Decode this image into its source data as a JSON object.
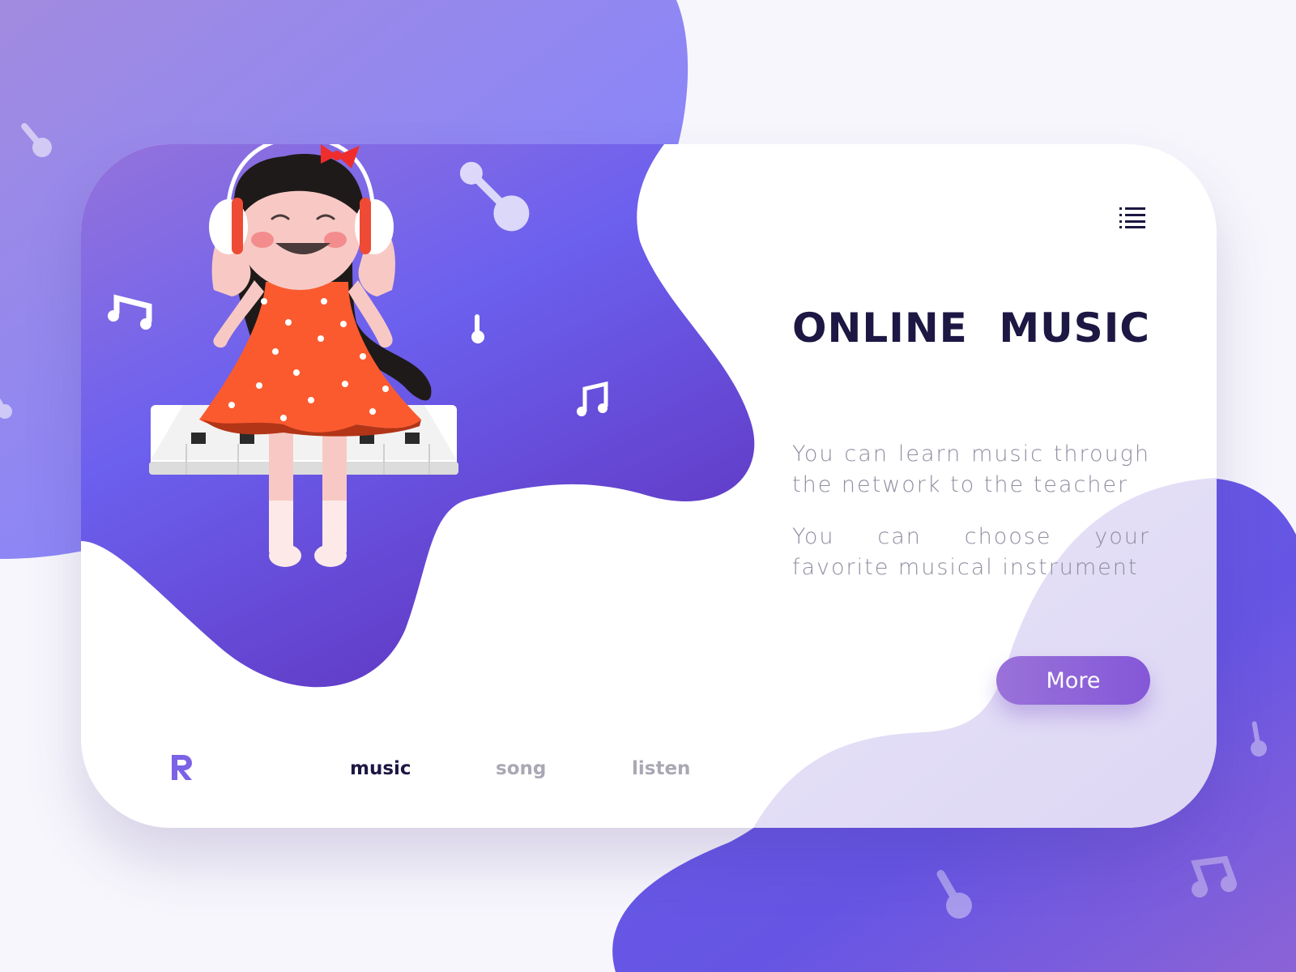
{
  "header": {
    "title_words": [
      "ONLINE",
      "MUSIC"
    ]
  },
  "content": {
    "paragraphs": [
      "You can learn music through the network to the teacher",
      "You can choose your favorite musical instrument"
    ],
    "more_button": "More"
  },
  "nav": {
    "items": [
      {
        "label": "music",
        "active": true
      },
      {
        "label": "song",
        "active": false
      },
      {
        "label": "listen",
        "active": false
      }
    ]
  },
  "icons": [
    "menu-icon",
    "logo-r-icon",
    "music-note-icon"
  ],
  "colors": {
    "accent": "#6b5ce8",
    "accent_light": "#8f84f5",
    "text_dark": "#1c1743",
    "text_muted": "#8f8da0",
    "button": "#8c62d8",
    "dress": "#fb5a2f"
  }
}
